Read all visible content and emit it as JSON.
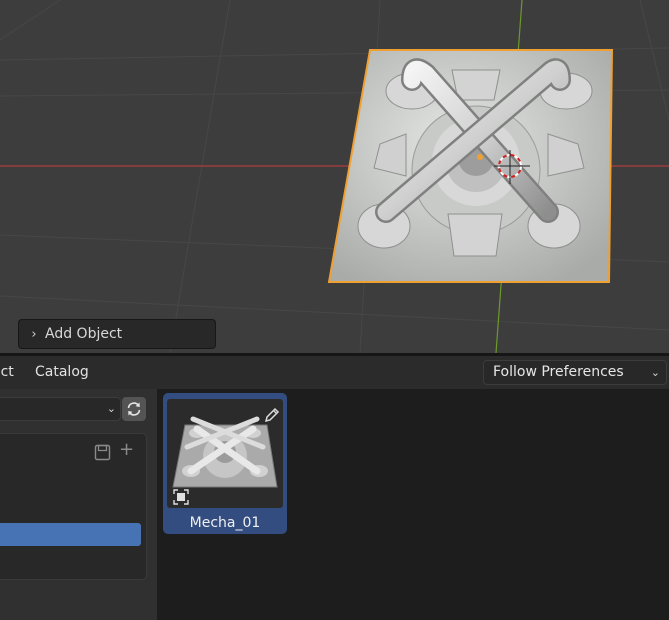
{
  "viewport": {
    "redo_panel": {
      "label": "Add Object",
      "chevron": "chevron-right-icon"
    }
  },
  "asset_browser": {
    "menu": {
      "select": "ect",
      "catalog": "Catalog"
    },
    "import_method": {
      "value": "Follow Preferences"
    },
    "library": {
      "value": ""
    },
    "asset": {
      "name": "Mecha_01"
    }
  },
  "colors": {
    "selection_orange": "#f0a030",
    "x_axis_red": "#b03c3c",
    "y_axis_green": "#6c9a2c",
    "active_blue": "#4772b3",
    "tile_blue": "#334d80"
  }
}
